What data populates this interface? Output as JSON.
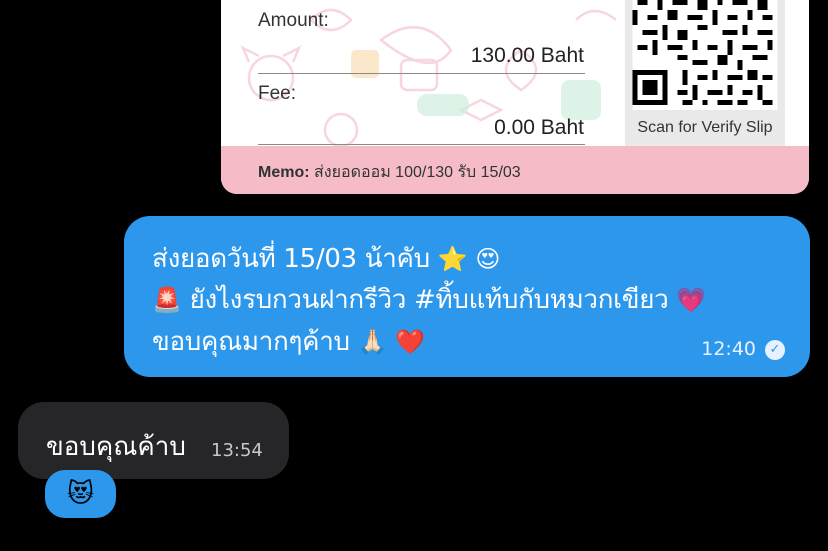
{
  "slip": {
    "amount_label": "Amount:",
    "amount_value": "130.00 Baht",
    "fee_label": "Fee:",
    "fee_value": "0.00 Baht",
    "qr_caption": "Scan for Verify Slip",
    "memo_label": "Memo:",
    "memo_text": "ส่งยอดออม 100/130 รับ 15/03"
  },
  "outgoing_message": {
    "line1_text": "ส่งยอดวันที่ 15/03 น้าคับ",
    "line1_emoji_1": "⭐",
    "line1_emoji_2": "😍",
    "line2_emoji_1": "🚨",
    "line2_text": "ยังไงรบกวนฝากรีวิว #ทิ้บแท้บกับหมวกเขียว",
    "line2_emoji_2": "💗",
    "line3_text": "ขอบคุณมากๆค้าบ",
    "line3_emoji_1": "🙏🏻",
    "line3_emoji_2": "❤️",
    "time": "12:40",
    "status_icon": "✓",
    "bubble_color": "#2d97ec"
  },
  "incoming_message": {
    "text": "ขอบคุณค้าบ",
    "time": "13:54",
    "reaction": "😻",
    "bubble_color": "#262628"
  }
}
